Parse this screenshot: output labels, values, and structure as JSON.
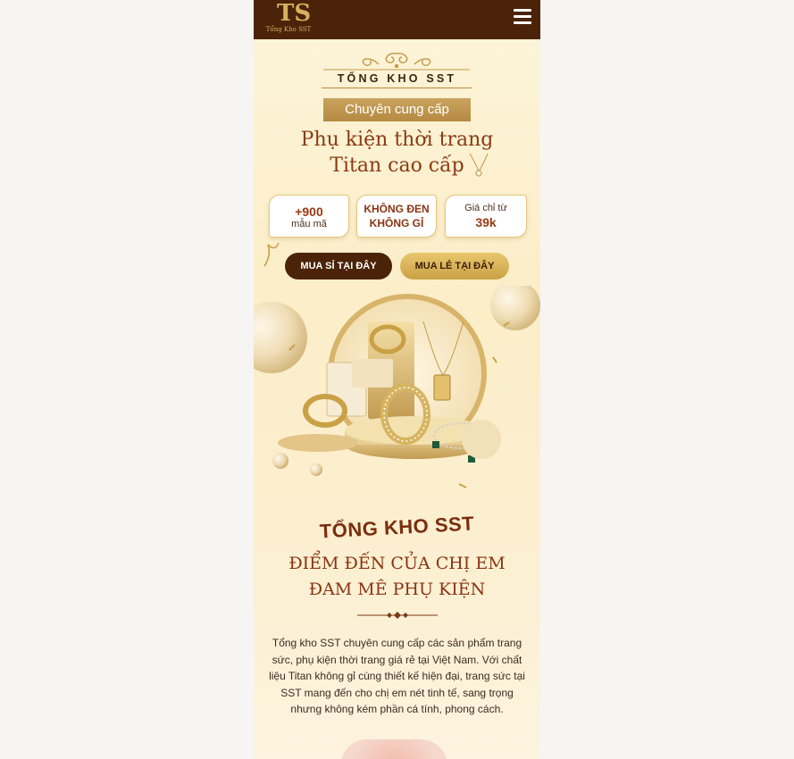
{
  "header": {
    "logo_text": "Tổng Kho SST",
    "logo_mark": "TS",
    "menu_icon": "hamburger-menu-icon"
  },
  "hero": {
    "brand": "TỔNG KHO SST",
    "tag": "Chuyên cung cấp",
    "headline_line1": "Phụ kiện thời trang",
    "headline_line2": "Titan cao cấp"
  },
  "badges": {
    "count_value": "+900",
    "count_label": "mẫu mã",
    "quality_line1": "KHÔNG ĐEN",
    "quality_line2": "KHÔNG GỈ",
    "price_label": "Giá chỉ từ",
    "price_value": "39k"
  },
  "buttons": {
    "wholesale": "MUA SỈ TẠI ĐÂY",
    "retail": "MUA LẺ TẠI ĐÂY"
  },
  "about": {
    "brand": "TỔNG KHO SST",
    "subtitle_line1": "ĐIỂM ĐẾN CỦA CHỊ EM",
    "subtitle_line2": "ĐAM MÊ PHỤ KIỆN",
    "description": "Tổng kho SST chuyên cung cấp các sản phẩm trang sức, phụ kiện thời trang giá rẻ tại Việt Nam. Với chất liệu Titan không gỉ cùng thiết kế hiện đại, trang sức tại SST mang đến cho chị em nét tinh tế, sang trọng nhưng không kém phần cá tính, phong cách."
  },
  "colors": {
    "header_bg": "#4a2308",
    "accent_gold": "#c9a45e",
    "brand_brown": "#8a3412",
    "page_bg": "#fbeec8"
  }
}
